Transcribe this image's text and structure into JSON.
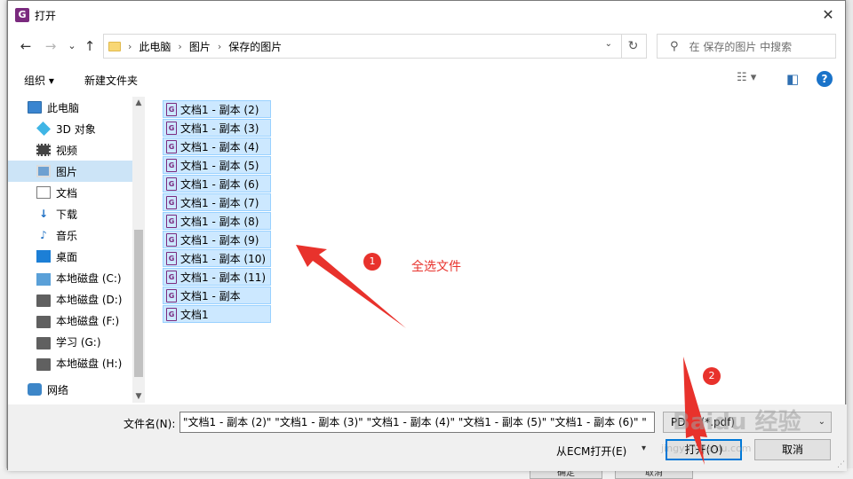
{
  "dialog": {
    "title": "打开",
    "app_icon_letter": "G",
    "close_glyph": "✕"
  },
  "nav": {
    "back_glyph": "←",
    "forward_glyph": "→",
    "recent_glyph": "⌄",
    "up_glyph": "↑",
    "breadcrumb": [
      "此电脑",
      "图片",
      "保存的图片"
    ],
    "separator": "›",
    "dropdown_glyph": "⌄",
    "refresh_glyph": "↻",
    "search_placeholder": "在 保存的图片 中搜索",
    "search_glyph": "⚲"
  },
  "toolbar": {
    "organize_label": "组织 ▾",
    "new_folder_label": "新建文件夹",
    "view_glyph": "☷ ▾",
    "preview_glyph": "◧",
    "help_glyph": "?"
  },
  "sidebar": {
    "items": [
      {
        "label": "此电脑",
        "icon": "computer-icon"
      },
      {
        "label": "3D 对象",
        "icon": "cube-icon"
      },
      {
        "label": "视频",
        "icon": "video-icon"
      },
      {
        "label": "图片",
        "icon": "pictures-icon"
      },
      {
        "label": "文档",
        "icon": "document-icon"
      },
      {
        "label": "下载",
        "icon": "download-icon"
      },
      {
        "label": "音乐",
        "icon": "music-icon"
      },
      {
        "label": "桌面",
        "icon": "desktop-icon"
      },
      {
        "label": "本地磁盘 (C:)",
        "icon": "drive-c-icon"
      },
      {
        "label": "本地磁盘 (D:)",
        "icon": "drive-icon"
      },
      {
        "label": "本地磁盘 (F:)",
        "icon": "drive-icon"
      },
      {
        "label": "学习 (G:)",
        "icon": "drive-icon"
      },
      {
        "label": "本地磁盘 (H:)",
        "icon": "drive-icon"
      },
      {
        "label": "网络",
        "icon": "network-icon"
      }
    ],
    "selected_index": 3,
    "scroll_up_glyph": "▲",
    "scroll_down_glyph": "▼"
  },
  "files": [
    "文档1 - 副本 (2)",
    "文档1 - 副本 (3)",
    "文档1 - 副本 (4)",
    "文档1 - 副本 (5)",
    "文档1 - 副本 (6)",
    "文档1 - 副本 (7)",
    "文档1 - 副本 (8)",
    "文档1 - 副本 (9)",
    "文档1 - 副本 (10)",
    "文档1 - 副本 (11)",
    "文档1 - 副本",
    "文档1"
  ],
  "bottom": {
    "filename_label": "文件名(N):",
    "filename_value": "\"文档1 - 副本 (2)\" \"文档1 - 副本 (3)\" \"文档1 - 副本 (4)\" \"文档1 - 副本 (5)\" \"文档1 - 副本 (6)\" \"",
    "filetype_value": "PDFs (*.pdf)",
    "filetype_dd": "⌄",
    "ecm_label": "从ECM打开(E)",
    "ecm_dd": "▾",
    "open_label": "打开(O)",
    "cancel_label": "取消",
    "grip_glyph": "⋰"
  },
  "background": {
    "btn_left": "确定",
    "btn_right": "取消"
  },
  "annotations": {
    "num1": "1",
    "label1": "全选文件",
    "num2": "2"
  },
  "watermark": {
    "text": "Baidu 经验",
    "sub": "jingyan.baidu.com"
  },
  "colors": {
    "accent": "#0078d7",
    "selection": "#cce8ff",
    "annotation": "#e8322c"
  }
}
